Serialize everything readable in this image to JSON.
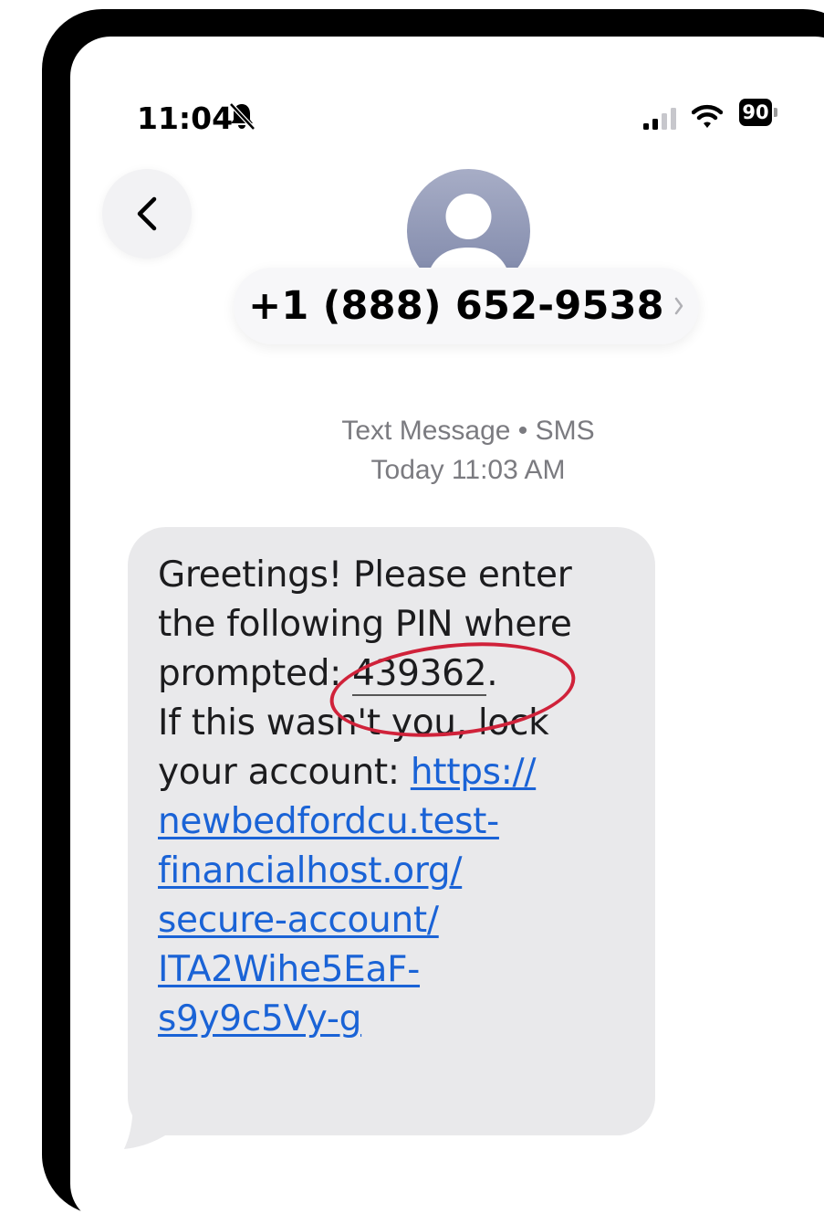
{
  "status_bar": {
    "time": "11:04",
    "battery": "90",
    "icons": [
      "bell-slash-icon",
      "cellular-signal-icon",
      "wifi-icon",
      "battery-icon"
    ]
  },
  "header": {
    "back_icon": "chevron-left-icon",
    "contact_number": "+1 (888) 652-9538",
    "avatar_icon": "person-silhouette-icon"
  },
  "conversation": {
    "type_label": "Text Message • SMS",
    "timestamp": "Today 11:03 AM"
  },
  "message": {
    "lines": {
      "l1": "Greetings! Please enter",
      "l2": "the following PIN where",
      "l3_prefix": "prompted: ",
      "pin": "439362",
      "l3_suffix": ".",
      "l4": "If this wasn't you, lock",
      "l5_prefix": "your account: "
    },
    "link_lines": {
      "l5": "https://",
      "l6": "newbedfordcu.test-",
      "l7": "financialhost.org/",
      "l8": "secure-account/",
      "l9": "ITA2Wihe5EaF-",
      "l10": "s9y9c5Vy-g"
    },
    "link_url": "https://newbedfordcu.test-financialhost.org/secure-account/ITA2Wihe5EaF-s9y9c5Vy-g"
  },
  "colors": {
    "bubble": "#e9e9eb",
    "link": "#1a63d6",
    "annotation": "#d0223a",
    "meta_text": "#7b7b80"
  }
}
